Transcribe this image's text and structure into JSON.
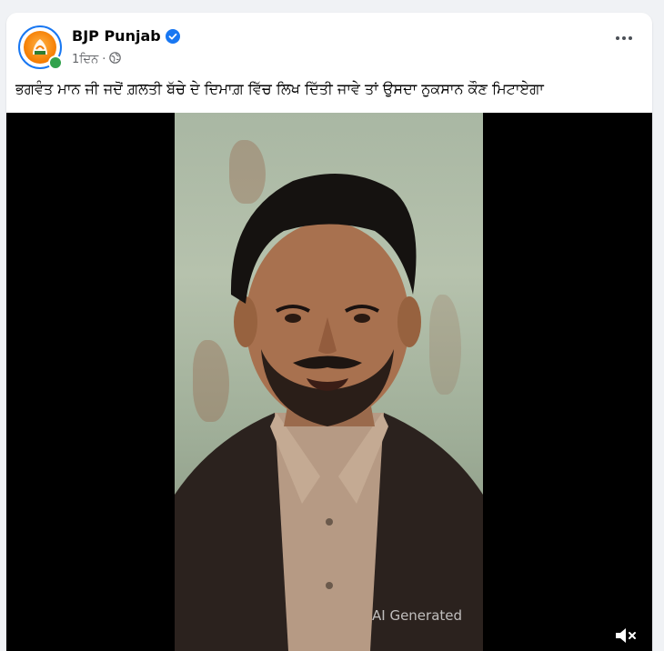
{
  "post": {
    "page_name": "BJP Punjab",
    "time": "1ਦਿਨ",
    "separator": "·",
    "caption": "ਭਗਵੰਤ ਮਾਨ ਜੀ ਜਦੋਂ ਗ਼ਲਤੀ ਬੱਚੇ ਦੇ ਦਿਮਾਗ਼ ਵਿੱਚ ਲਿਖ ਦਿੱਤੀ ਜਾਵੇ ਤਾਂ ਉਸਦਾ ਨੁਕਸਾਨ ਕੌਣ ਮਿਟਾਏਗਾ"
  },
  "video": {
    "watermark": "AI Generated"
  },
  "icons": {
    "verified": "verified-badge-icon",
    "privacy": "globe-icon",
    "more": "more-options-icon",
    "mute": "muted-speaker-icon"
  },
  "colors": {
    "verified_blue": "#1877f2",
    "online_green": "#31a24c",
    "brand_orange": "#f57c00"
  }
}
